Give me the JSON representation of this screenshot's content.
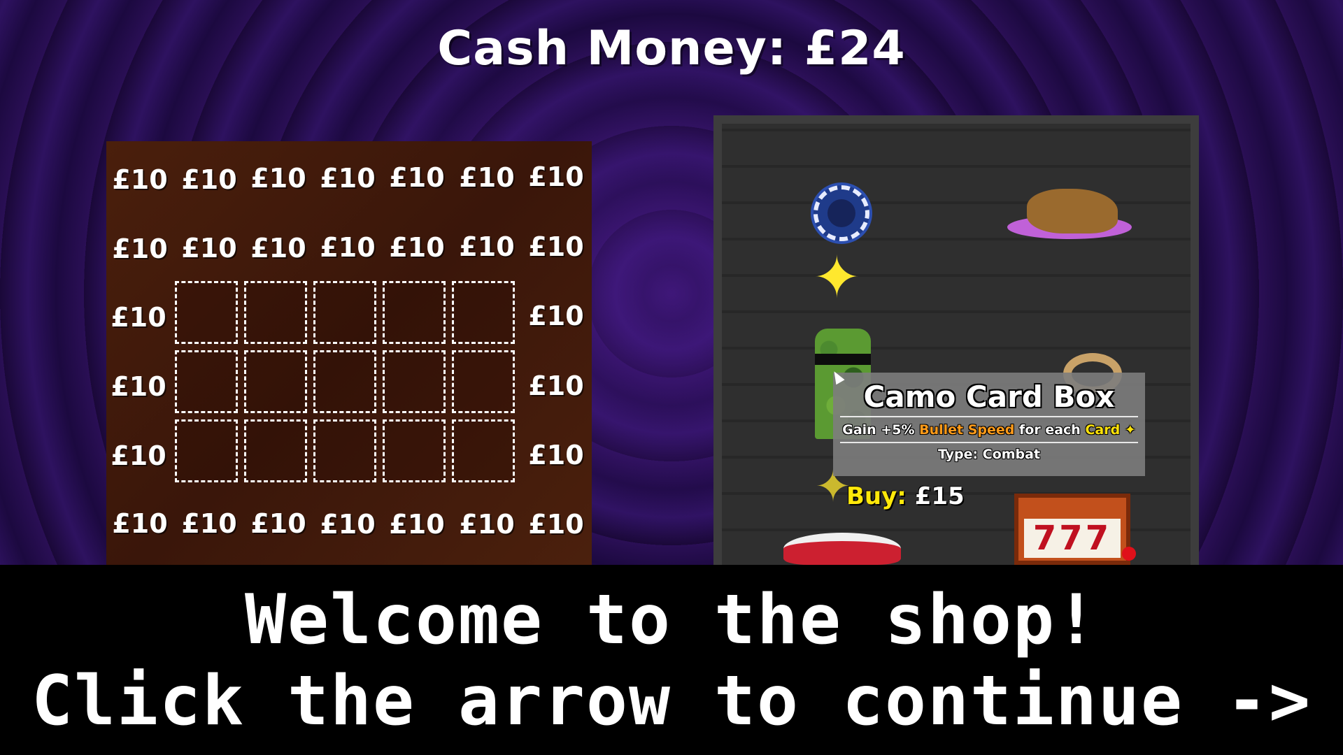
{
  "header": {
    "cash_label": "Cash Money: £24"
  },
  "board": {
    "price_label": "£10",
    "top_rows": [
      [
        "£10",
        "£10",
        "£10",
        "£10",
        "£10",
        "£10",
        "£10"
      ],
      [
        "£10",
        "£10",
        "£10",
        "£10",
        "£10",
        "£10",
        "£10"
      ]
    ],
    "side_prices_left": [
      "£10",
      "£10",
      "£10"
    ],
    "side_prices_right": [
      "£10",
      "£10",
      "£10"
    ],
    "bottom_row": [
      "£10",
      "£10",
      "£10",
      "£10",
      "£10",
      "£10",
      "£10"
    ],
    "empty_slot_grid": {
      "rows": 3,
      "cols": 5
    }
  },
  "shop": {
    "items": [
      "poker-chip-icon",
      "chicken-nugget-icon",
      "sparkle-icon",
      "camo-card-box-icon",
      "ring-icon",
      "plate-icon",
      "slot-machine-icon"
    ],
    "slot_machine_text": "777",
    "tooltip": {
      "title": "Camo Card Box",
      "desc_prefix": "Gain +5%",
      "desc_stat": "Bullet Speed",
      "desc_mid": "for each",
      "desc_card": "Card",
      "desc_icon": "✦",
      "type": "Type: Combat"
    },
    "buy": {
      "label": "Buy:",
      "price": "£15"
    },
    "colors": {
      "stat": "#ff9b1a",
      "card": "#ffe20a",
      "buy_label": "#ffe80a"
    }
  },
  "dialog": {
    "line1": "Welcome to the shop!",
    "line2": "Click the arrow to continue ->"
  }
}
